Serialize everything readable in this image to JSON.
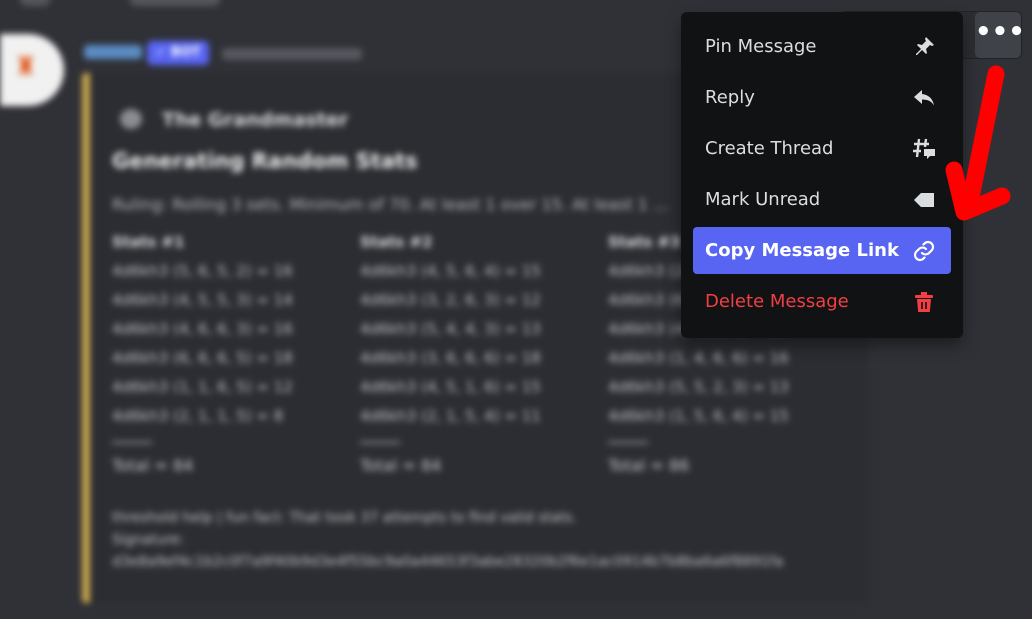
{
  "message": {
    "badge": "✓ BOT",
    "embed": {
      "author": "The Grandmaster",
      "title": "Generating Random Stats",
      "description": "Ruling: Rolling 3 sets. Minimum of 70. At least 1 over 15. At least 1 ...",
      "fields": [
        {
          "name": "Stats #1",
          "lines": [
            "4d6kh3 (5, 6, 5, 2) = 16",
            "4d6kh3 (4, 5, 5, 3) = 14",
            "4d6kh3 (4, 6, 6, 3) = 16",
            "4d6kh3 (6, 6, 6, 5) = 18",
            "4d6kh3 (1, 1, 6, 5) = 12",
            "4d6kh3 (2, 1, 1, 5) = 8"
          ],
          "total": "Total = 84"
        },
        {
          "name": "Stats #2",
          "lines": [
            "4d6kh3 (4, 5, 6, 4) = 15",
            "4d6kh3 (3, 2, 6, 3) = 12",
            "4d6kh3 (5, 4, 4, 3) = 13",
            "4d6kh3 (3, 6, 6, 6) = 18",
            "4d6kh3 (4, 5, 1, 6) = 15",
            "4d6kh3 (2, 1, 5, 4) = 11"
          ],
          "total": "Total = 84"
        },
        {
          "name": "Stats #3",
          "lines": [
            "4d6kh3 (2, 3, 4, 6) = 13",
            "4d6kh3 (6, 1, 4, 5) = 15",
            "4d6kh3 (4, 4, 3, 6) = 14",
            "4d6kh3 (1, 4, 6, 6) = 16",
            "4d6kh3 (5, 5, 2, 3) = 13",
            "4d6kh3 (1, 5, 6, 4) = 15"
          ],
          "total": "Total = 86"
        }
      ],
      "footer": [
        "threshold help | fun fact: That took 37 attempts to find valid stats.",
        "Signature:",
        "d3e8a9ef4c1b2c0f7a9f40b9d3e4f55bc9a0a44653f3abe28320b2f6e1ac0914b7b8ba6a6f8891fa"
      ]
    }
  },
  "toolbar": {
    "more_glyph": "•••"
  },
  "menu": {
    "items": [
      {
        "label": "Pin Message",
        "icon": "pin-icon",
        "state": "normal"
      },
      {
        "label": "Reply",
        "icon": "reply-icon",
        "state": "normal"
      },
      {
        "label": "Create Thread",
        "icon": "thread-icon",
        "state": "normal"
      },
      {
        "label": "Mark Unread",
        "icon": "mark-unread-icon",
        "state": "normal"
      },
      {
        "label": "Copy Message Link",
        "icon": "link-icon",
        "state": "highlighted"
      },
      {
        "label": "Delete Message",
        "icon": "trash-icon",
        "state": "danger"
      }
    ]
  },
  "colors": {
    "background": "#303137",
    "menu_background": "#111214",
    "highlight": "#5865f2",
    "danger": "#f23f43",
    "embed_accent": "#c9a74e",
    "annotation": "#ff0000"
  }
}
